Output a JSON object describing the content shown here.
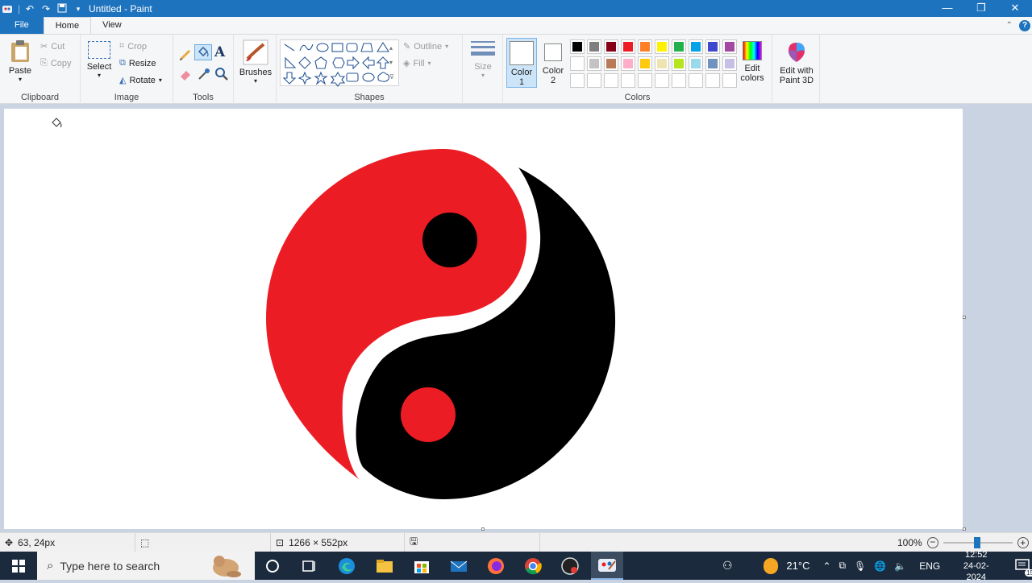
{
  "window": {
    "title": "Untitled - Paint"
  },
  "tabs": {
    "file": "File",
    "home": "Home",
    "view": "View"
  },
  "clipboard": {
    "paste": "Paste",
    "cut": "Cut",
    "copy": "Copy",
    "label": "Clipboard"
  },
  "image": {
    "select": "Select",
    "crop": "Crop",
    "resize": "Resize",
    "rotate": "Rotate",
    "label": "Image"
  },
  "tools": {
    "label": "Tools"
  },
  "brushes": {
    "label": "Brushes"
  },
  "shapes": {
    "outline": "Outline",
    "fill": "Fill",
    "label": "Shapes"
  },
  "size": {
    "label": "Size"
  },
  "colors": {
    "color1": "Color\n1",
    "color1_a": "Color",
    "color1_b": "1",
    "color2_a": "Color",
    "color2_b": "2",
    "edit_a": "Edit",
    "edit_b": "colors",
    "label": "Colors",
    "palette_row1": [
      "#000000",
      "#7f7f7f",
      "#880015",
      "#ed1c24",
      "#ff7f27",
      "#fff200",
      "#22b14c",
      "#00a2e8",
      "#3f48cc",
      "#a349a4"
    ],
    "palette_row2": [
      "#ffffff",
      "#c3c3c3",
      "#b97a57",
      "#ffaec9",
      "#ffc90e",
      "#efe4b0",
      "#b5e61d",
      "#99d9ea",
      "#7092be",
      "#c8bfe7"
    ],
    "color1_value": "#ffffff",
    "color2_value": "#ffffff"
  },
  "paint3d": {
    "a": "Edit with",
    "b": "Paint 3D"
  },
  "status": {
    "cursor": "63, 24px",
    "size": "1266 × 552px",
    "zoom": "100%"
  },
  "taskbar": {
    "search_placeholder": "Type here to search",
    "weather": "21°C",
    "lang": "ENG",
    "time": "12:52",
    "date": "24-02-2024",
    "notifications": "15"
  },
  "drawing": {
    "red": "#ec1c24",
    "black": "#000000"
  }
}
